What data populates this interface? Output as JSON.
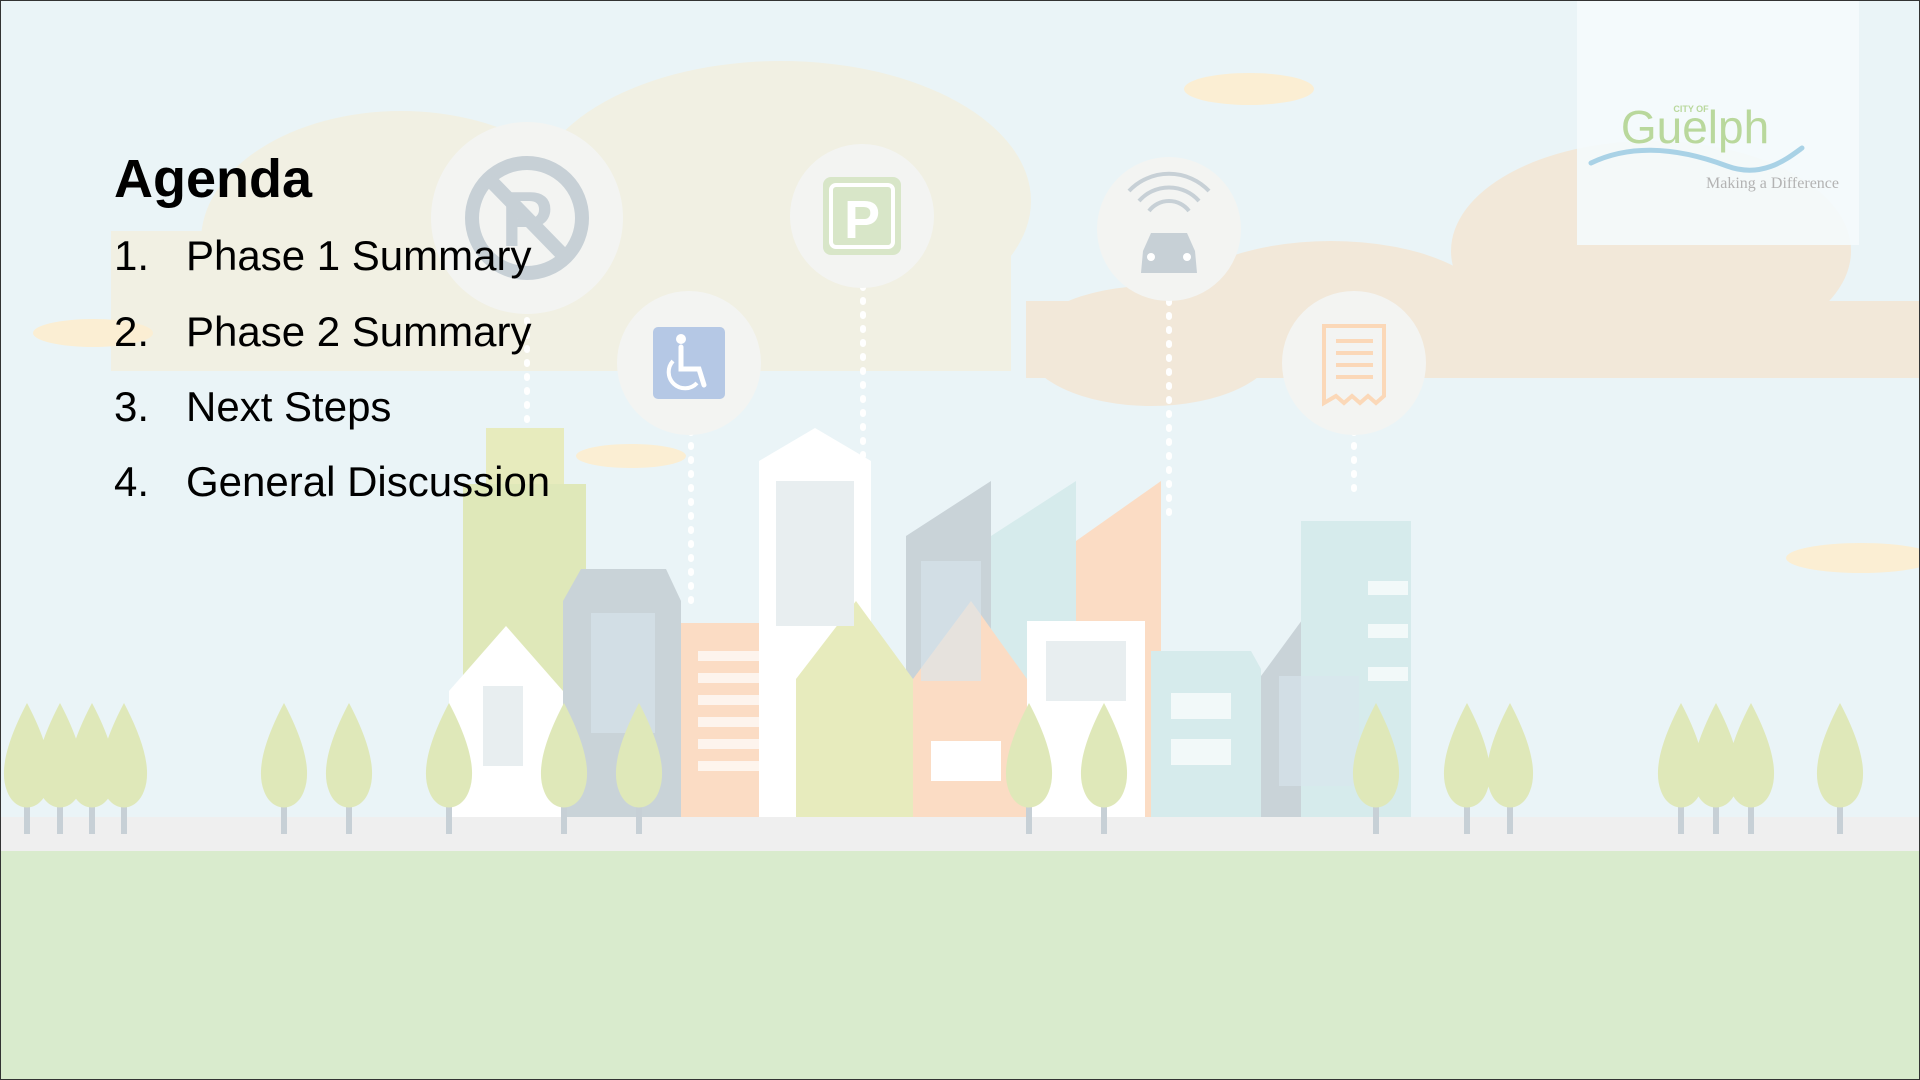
{
  "slide": {
    "title": "Agenda",
    "items": [
      {
        "number": "1.",
        "label": "Phase 1 Summary"
      },
      {
        "number": "2.",
        "label": "Phase 2 Summary"
      },
      {
        "number": "3.",
        "label": "Next Steps"
      },
      {
        "number": "4.",
        "label": "General Discussion"
      }
    ]
  },
  "logo": {
    "small_text": "CITY OF",
    "name": "Guelph",
    "tagline": "Making a Difference"
  },
  "icons": [
    "no-parking-icon",
    "parking-icon",
    "wheelchair-accessible-icon",
    "connected-car-icon",
    "parking-receipt-icon"
  ],
  "colors": {
    "sky": "#eaf4f7",
    "ground": "#d9ebcd",
    "street": "#efefef",
    "logo_green": "#b9d89c",
    "logo_wave": "#a9d2e6",
    "tree": "#dfe8b9"
  }
}
